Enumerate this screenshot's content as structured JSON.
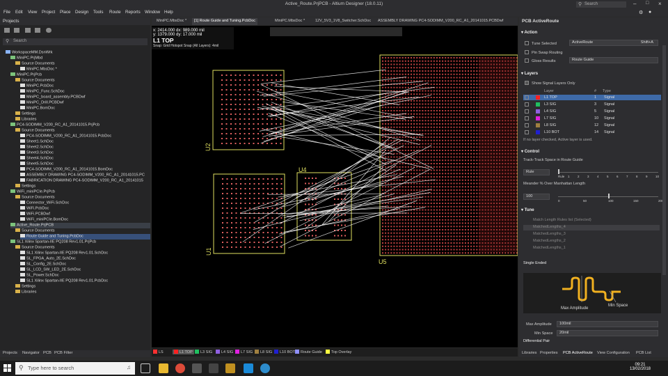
{
  "window": {
    "title": "Active_Route.PrjPCB - Altium Designer (18.0.11)",
    "search_placeholder": "Search"
  },
  "menu": [
    "File",
    "Edit",
    "View",
    "Project",
    "Place",
    "Design",
    "Tools",
    "Route",
    "Reports",
    "Window",
    "Help"
  ],
  "projects_panel": {
    "title": "Projects",
    "search_placeholder": "Search",
    "tree": [
      "WorkspaceMM.DsnWrk",
      "MiniPC.PrjMbd",
      "Source Documents",
      "MiniPC.MbsDoc *",
      "MiniPC.PrjPcb",
      "Source Documents",
      "MiniPC.PcbDoc",
      "MiniPC_Func.SchDoc",
      "MiniPC_board_assembly.PCBDwf",
      "MiniPC_Drill.PCBDwf",
      "MiniPC.BomDoc",
      "Settings",
      "Libraries",
      "PC4-SODIMM_V200_RC_A1_20141015.PrjPcb",
      "Source Documents",
      "PC4-SODIMM_V200_RC_A1_20141015.PcbDoc",
      "Sheet1.SchDoc",
      "Sheet2.SchDoc",
      "Sheet3.SchDoc",
      "Sheet4.SchDoc",
      "Sheet5.SchDoc",
      "PC4-SODIMM_V200_RC_A1_20141015.BomDoc",
      "ASSEMBLY DRAWING PC4-SODIMM_V200_RC_A1_20141015.PC",
      "FABRICATION DRAWING PC4-SODIMM_V200_RC_A1_20141015",
      "Settings",
      "WiFi_miniPCIe.PrjPcb",
      "Source Documents",
      "Connector_WiFi.SchDoc",
      "WiFi.PcbDoc",
      "WiFi.PCBDwf",
      "WiFi_miniPCIe.BomDoc",
      "Active_Route.PrjPCB",
      "Source Documents",
      "Route Guide and Tuning.PcbDoc",
      "SL1 Xilinx Spartan-IIE PQ208 Rev1.01.PrjPcb",
      "Source Documents",
      "SL1 Xilinx Spartan-IIE PQ208 Rev1.01.SchDoc",
      "SL_FPGA_Auto_2E.SchDoc",
      "SL_Config_2E.SchDoc",
      "SL_LCD_SW_LED_2E.SchDoc",
      "SL_Power.SchDoc",
      "SL1 Xilinx Spartan-IIE PQ208 Rev1.01.PcbDoc",
      "Settings",
      "Libraries"
    ]
  },
  "bottom_tabs_left": [
    "Projects",
    "Navigator",
    "PCB",
    "PCB Filter"
  ],
  "doc_tabs": [
    "MiniPC.MbsDoc *",
    "[1] Route Guide and Tuning.PcbDoc",
    "MiniPC.MbsDoc *",
    "12V_5V3_1V8_Switcher.SchDoc",
    "ASSEMBLY DRAWING PC4-SODIMM_V200_RC_A1_20141015.PCBDwf"
  ],
  "coords": {
    "line1": "x: 2414.000  dx: 989.000 mil",
    "line2": "y: 1379.000  dy: 17.000  mil",
    "layer": "L1 TOP",
    "snap": "Snap: Grid Hotspot Snap (All Layers): 4mil"
  },
  "designators": [
    "U2",
    "U4",
    "U1",
    "U5"
  ],
  "layer_tabs": [
    "LS",
    "L1 TOP",
    "L3 SIG",
    "L4 SIG",
    "L7 SIG",
    "L8 SIG",
    "L10 BOT",
    "Route Guide",
    "Top Overlay"
  ],
  "layer_tab_colors": [
    "#ff3030",
    "#ff2020",
    "#20c060",
    "#9060e0",
    "#e020e0",
    "#a08040",
    "#2020d0",
    "#9090ff",
    "#ffff40"
  ],
  "right_panel": {
    "title": "PCB ActiveRoute",
    "action": {
      "heading": "Action",
      "tune_selected": "Tune Selected",
      "activeroute": "ActiveRoute",
      "shortcut": "Shift+A",
      "pin_swap": "Pin Swap Routing",
      "gloss": "Gloss Results",
      "route_guide": "Route Guide"
    },
    "layers": {
      "heading": "Layers",
      "show_signal": "Show Signal Layers Only",
      "col_layer": "Layer",
      "col_num": "#",
      "col_type": "Type",
      "rows": [
        {
          "name": "L1 TOP",
          "num": "1",
          "type": "Signal",
          "color": "#ff2020"
        },
        {
          "name": "L3 SIG",
          "num": "3",
          "type": "Signal",
          "color": "#20c060"
        },
        {
          "name": "L4 SIG",
          "num": "5",
          "type": "Signal",
          "color": "#9060e0"
        },
        {
          "name": "L7 SIG",
          "num": "10",
          "type": "Signal",
          "color": "#e020e0"
        },
        {
          "name": "L8 SIG",
          "num": "12",
          "type": "Signal",
          "color": "#a08040"
        },
        {
          "name": "L10 BOT",
          "num": "14",
          "type": "Signal",
          "color": "#2020d0"
        }
      ],
      "note": "If no layer checked, Active layer is used."
    },
    "control": {
      "heading": "Control",
      "track_space": "Track-Track Space in Route Guide",
      "rule": "Rule",
      "rule_ticks": [
        "Rule",
        "1",
        "2",
        "3",
        "4",
        "5",
        "6",
        "7",
        "8",
        "9",
        "10"
      ],
      "rule_level": 0,
      "meander": "Meander % Over Manhattan Length",
      "meander_value": "100",
      "meander_ticks": [
        "0",
        "50",
        "100",
        "150",
        "200"
      ]
    },
    "tune": {
      "heading": "Tune",
      "items": [
        "Match Length Rules list (Selected)",
        "MatchedLengths_4",
        "MatchedLengths_3",
        "MatchedLengths_2",
        "MatchedLengths_1"
      ]
    },
    "single_ended": "Single Ended",
    "diagram": {
      "max_amplitude": "Max Amplitude",
      "min_space": "Min Space"
    },
    "max_amplitude_label": "Max Amplitude",
    "max_amplitude_value": "100mil",
    "min_space_label": "Min Space",
    "min_space_value": "20mil",
    "differential": "Differential Pair"
  },
  "right_tabs": [
    "Libraries",
    "Properties",
    "PCB ActiveRoute",
    "View Configuration",
    "PCB List"
  ],
  "taskbar": {
    "search_placeholder": "Type here to search",
    "time": "09:21",
    "date": "13/02/2018"
  }
}
